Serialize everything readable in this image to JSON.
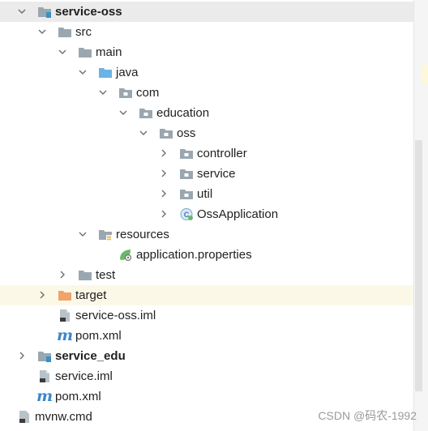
{
  "tree": {
    "module_root": "service-oss",
    "src": "src",
    "main": "main",
    "java": "java",
    "com": "com",
    "education": "education",
    "oss": "oss",
    "controller": "controller",
    "service": "service",
    "util": "util",
    "app_class": "OssApplication",
    "resources": "resources",
    "properties": "application.properties",
    "test": "test",
    "target": "target",
    "iml": "service-oss.iml",
    "pom1": "pom.xml",
    "service_edu": "service_edu",
    "service_iml": "service.iml",
    "pom2": "pom.xml",
    "mvnw": "mvnw.cmd",
    "maven_glyph": "m"
  },
  "watermark": "CSDN @码农-1992",
  "colors": {
    "folder": "#9aa7b0",
    "source_folder": "#6bb2e5",
    "target_folder": "#f0a46a",
    "highlight_row": "#fcf8e8",
    "module_badge": "#3592c4"
  }
}
